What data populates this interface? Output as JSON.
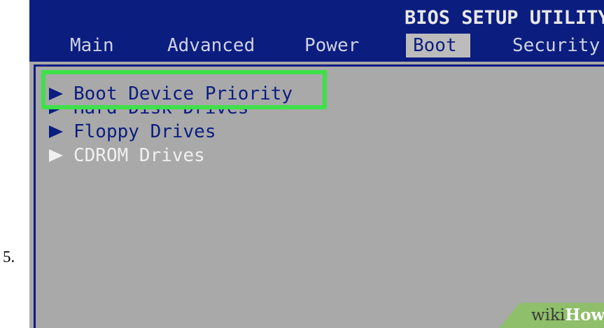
{
  "step_number": "5.",
  "bios": {
    "title": "BIOS SETUP UTILITY",
    "tabs": {
      "main": "Main",
      "advanced": "Advanced",
      "power": "Power",
      "boot": "Boot",
      "security": "Security"
    },
    "selected_tab": "Boot",
    "menu": {
      "boot_device_priority": "Boot Device Priority",
      "hard_disk_drives": "Hard Disk Drives",
      "floppy_drives": "Floppy Drives",
      "cdrom_drives": "CDROM Drives"
    }
  },
  "watermark": {
    "wiki": "wiki",
    "how": "How"
  },
  "colors": {
    "bios_blue": "#0b1d7f",
    "bios_gray": "#a9a9a9",
    "highlight_green": "#3fe04a"
  }
}
